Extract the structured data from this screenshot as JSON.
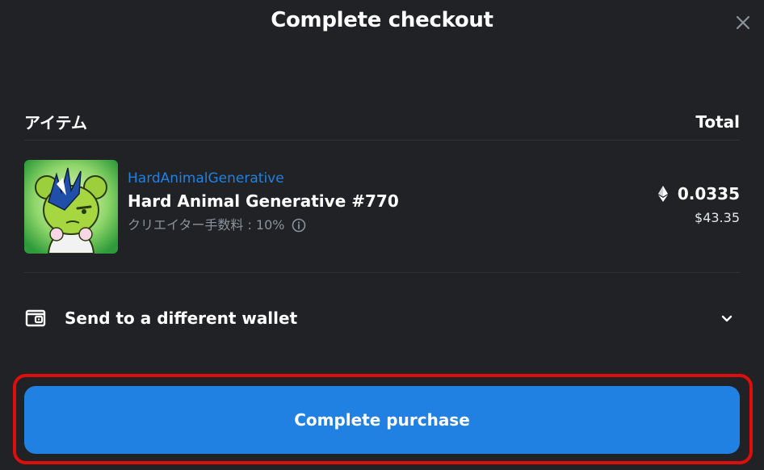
{
  "modal": {
    "title": "Complete checkout",
    "close_icon": "close-icon"
  },
  "table": {
    "item_header": "アイテム",
    "total_header": "Total"
  },
  "item": {
    "collection": "HardAnimalGenerative",
    "name": "Hard Animal Generative #770",
    "creator_fee": "クリエイター手数料 : 10%",
    "eth_price": "0.0335",
    "usd_price": "$43.35",
    "thumbnail_icon": "nft-thumbnail"
  },
  "wallet": {
    "label": "Send to a different wallet",
    "icon": "wallet-icon",
    "expand_icon": "chevron-down-icon"
  },
  "actions": {
    "purchase_label": "Complete purchase"
  },
  "colors": {
    "background": "#202225",
    "accent": "#2081e2",
    "highlight": "#e00d0d",
    "muted_text": "#8a939b"
  }
}
